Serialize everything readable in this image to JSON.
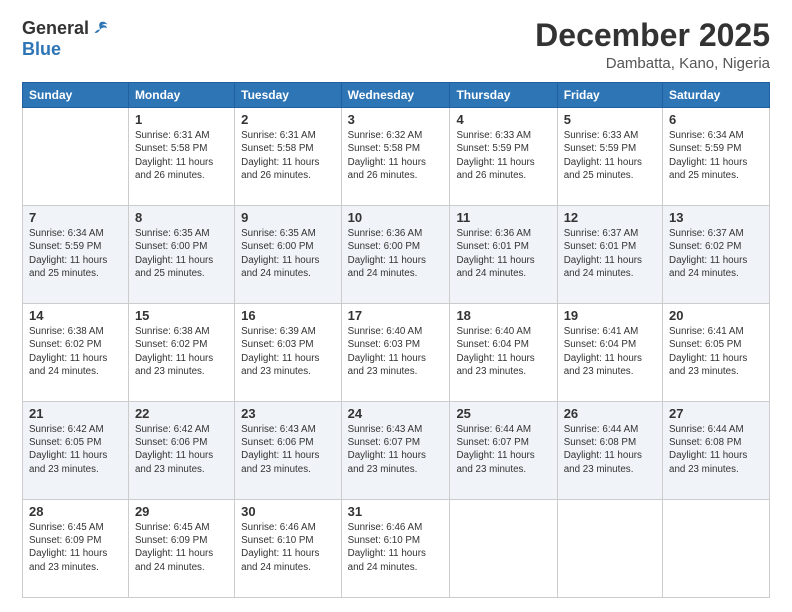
{
  "header": {
    "logo": {
      "general": "General",
      "blue": "Blue"
    },
    "title": "December 2025",
    "subtitle": "Dambatta, Kano, Nigeria"
  },
  "calendar": {
    "days": [
      "Sunday",
      "Monday",
      "Tuesday",
      "Wednesday",
      "Thursday",
      "Friday",
      "Saturday"
    ],
    "weeks": [
      [
        {
          "day": "",
          "sunrise": "",
          "sunset": "",
          "daylight": ""
        },
        {
          "day": "1",
          "sunrise": "Sunrise: 6:31 AM",
          "sunset": "Sunset: 5:58 PM",
          "daylight": "Daylight: 11 hours and 26 minutes."
        },
        {
          "day": "2",
          "sunrise": "Sunrise: 6:31 AM",
          "sunset": "Sunset: 5:58 PM",
          "daylight": "Daylight: 11 hours and 26 minutes."
        },
        {
          "day": "3",
          "sunrise": "Sunrise: 6:32 AM",
          "sunset": "Sunset: 5:58 PM",
          "daylight": "Daylight: 11 hours and 26 minutes."
        },
        {
          "day": "4",
          "sunrise": "Sunrise: 6:33 AM",
          "sunset": "Sunset: 5:59 PM",
          "daylight": "Daylight: 11 hours and 26 minutes."
        },
        {
          "day": "5",
          "sunrise": "Sunrise: 6:33 AM",
          "sunset": "Sunset: 5:59 PM",
          "daylight": "Daylight: 11 hours and 25 minutes."
        },
        {
          "day": "6",
          "sunrise": "Sunrise: 6:34 AM",
          "sunset": "Sunset: 5:59 PM",
          "daylight": "Daylight: 11 hours and 25 minutes."
        }
      ],
      [
        {
          "day": "7",
          "sunrise": "Sunrise: 6:34 AM",
          "sunset": "Sunset: 5:59 PM",
          "daylight": "Daylight: 11 hours and 25 minutes."
        },
        {
          "day": "8",
          "sunrise": "Sunrise: 6:35 AM",
          "sunset": "Sunset: 6:00 PM",
          "daylight": "Daylight: 11 hours and 25 minutes."
        },
        {
          "day": "9",
          "sunrise": "Sunrise: 6:35 AM",
          "sunset": "Sunset: 6:00 PM",
          "daylight": "Daylight: 11 hours and 24 minutes."
        },
        {
          "day": "10",
          "sunrise": "Sunrise: 6:36 AM",
          "sunset": "Sunset: 6:00 PM",
          "daylight": "Daylight: 11 hours and 24 minutes."
        },
        {
          "day": "11",
          "sunrise": "Sunrise: 6:36 AM",
          "sunset": "Sunset: 6:01 PM",
          "daylight": "Daylight: 11 hours and 24 minutes."
        },
        {
          "day": "12",
          "sunrise": "Sunrise: 6:37 AM",
          "sunset": "Sunset: 6:01 PM",
          "daylight": "Daylight: 11 hours and 24 minutes."
        },
        {
          "day": "13",
          "sunrise": "Sunrise: 6:37 AM",
          "sunset": "Sunset: 6:02 PM",
          "daylight": "Daylight: 11 hours and 24 minutes."
        }
      ],
      [
        {
          "day": "14",
          "sunrise": "Sunrise: 6:38 AM",
          "sunset": "Sunset: 6:02 PM",
          "daylight": "Daylight: 11 hours and 24 minutes."
        },
        {
          "day": "15",
          "sunrise": "Sunrise: 6:38 AM",
          "sunset": "Sunset: 6:02 PM",
          "daylight": "Daylight: 11 hours and 23 minutes."
        },
        {
          "day": "16",
          "sunrise": "Sunrise: 6:39 AM",
          "sunset": "Sunset: 6:03 PM",
          "daylight": "Daylight: 11 hours and 23 minutes."
        },
        {
          "day": "17",
          "sunrise": "Sunrise: 6:40 AM",
          "sunset": "Sunset: 6:03 PM",
          "daylight": "Daylight: 11 hours and 23 minutes."
        },
        {
          "day": "18",
          "sunrise": "Sunrise: 6:40 AM",
          "sunset": "Sunset: 6:04 PM",
          "daylight": "Daylight: 11 hours and 23 minutes."
        },
        {
          "day": "19",
          "sunrise": "Sunrise: 6:41 AM",
          "sunset": "Sunset: 6:04 PM",
          "daylight": "Daylight: 11 hours and 23 minutes."
        },
        {
          "day": "20",
          "sunrise": "Sunrise: 6:41 AM",
          "sunset": "Sunset: 6:05 PM",
          "daylight": "Daylight: 11 hours and 23 minutes."
        }
      ],
      [
        {
          "day": "21",
          "sunrise": "Sunrise: 6:42 AM",
          "sunset": "Sunset: 6:05 PM",
          "daylight": "Daylight: 11 hours and 23 minutes."
        },
        {
          "day": "22",
          "sunrise": "Sunrise: 6:42 AM",
          "sunset": "Sunset: 6:06 PM",
          "daylight": "Daylight: 11 hours and 23 minutes."
        },
        {
          "day": "23",
          "sunrise": "Sunrise: 6:43 AM",
          "sunset": "Sunset: 6:06 PM",
          "daylight": "Daylight: 11 hours and 23 minutes."
        },
        {
          "day": "24",
          "sunrise": "Sunrise: 6:43 AM",
          "sunset": "Sunset: 6:07 PM",
          "daylight": "Daylight: 11 hours and 23 minutes."
        },
        {
          "day": "25",
          "sunrise": "Sunrise: 6:44 AM",
          "sunset": "Sunset: 6:07 PM",
          "daylight": "Daylight: 11 hours and 23 minutes."
        },
        {
          "day": "26",
          "sunrise": "Sunrise: 6:44 AM",
          "sunset": "Sunset: 6:08 PM",
          "daylight": "Daylight: 11 hours and 23 minutes."
        },
        {
          "day": "27",
          "sunrise": "Sunrise: 6:44 AM",
          "sunset": "Sunset: 6:08 PM",
          "daylight": "Daylight: 11 hours and 23 minutes."
        }
      ],
      [
        {
          "day": "28",
          "sunrise": "Sunrise: 6:45 AM",
          "sunset": "Sunset: 6:09 PM",
          "daylight": "Daylight: 11 hours and 23 minutes."
        },
        {
          "day": "29",
          "sunrise": "Sunrise: 6:45 AM",
          "sunset": "Sunset: 6:09 PM",
          "daylight": "Daylight: 11 hours and 24 minutes."
        },
        {
          "day": "30",
          "sunrise": "Sunrise: 6:46 AM",
          "sunset": "Sunset: 6:10 PM",
          "daylight": "Daylight: 11 hours and 24 minutes."
        },
        {
          "day": "31",
          "sunrise": "Sunrise: 6:46 AM",
          "sunset": "Sunset: 6:10 PM",
          "daylight": "Daylight: 11 hours and 24 minutes."
        },
        {
          "day": "",
          "sunrise": "",
          "sunset": "",
          "daylight": ""
        },
        {
          "day": "",
          "sunrise": "",
          "sunset": "",
          "daylight": ""
        },
        {
          "day": "",
          "sunrise": "",
          "sunset": "",
          "daylight": ""
        }
      ]
    ]
  }
}
